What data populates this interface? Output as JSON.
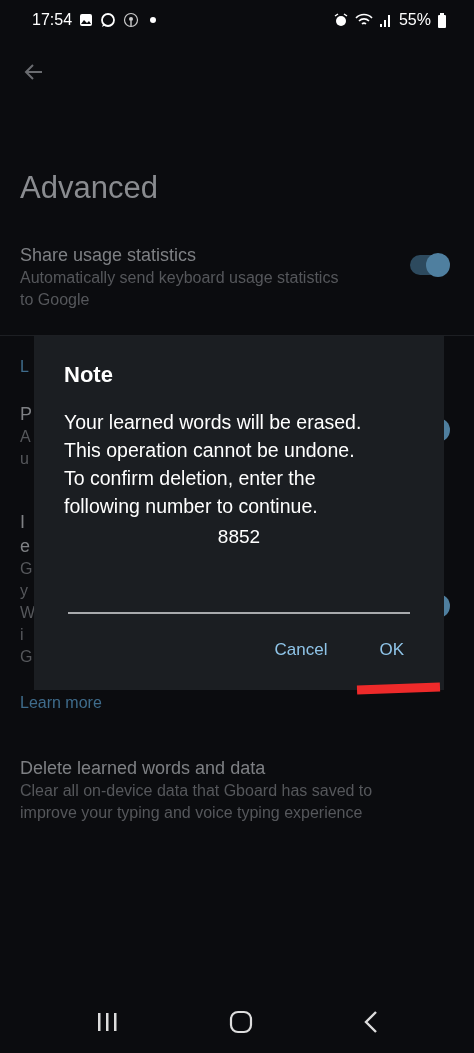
{
  "status_bar": {
    "time": "17:54",
    "battery": "55%"
  },
  "page": {
    "title": "Advanced",
    "settings": [
      {
        "title": "Share usage statistics",
        "lines": [
          "Automatically send keyboard usage statistics",
          "to Google"
        ],
        "toggle": {
          "on": true
        }
      },
      {
        "kind": "link",
        "lines": [
          "L"
        ]
      },
      {
        "title": "P",
        "lines": [
          "A",
          "u"
        ],
        "toggle": {
          "on": true
        }
      },
      {
        "title": "I",
        "title2": "e",
        "lines": [
          "G",
          "y",
          "W",
          "i",
          "G"
        ],
        "toggle": {
          "on": true
        }
      },
      {
        "kind": "link",
        "lines": [
          "Learn more"
        ]
      },
      {
        "title": "Delete learned words and data",
        "lines": [
          "Clear all on-device data that Gboard has saved to",
          "improve your typing and voice typing experience"
        ]
      }
    ]
  },
  "dialog": {
    "title": "Note",
    "message": [
      "Your learned words will be erased.",
      "This operation cannot be undone.",
      "To confirm deletion, enter the",
      "following number to continue."
    ],
    "number": "8852",
    "buttons": [
      "Cancel",
      "OK"
    ]
  }
}
